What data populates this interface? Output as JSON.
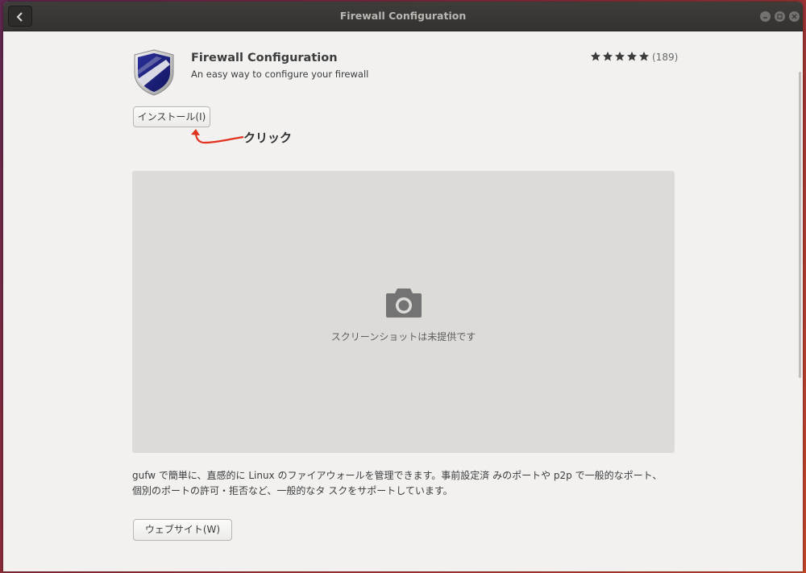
{
  "window": {
    "title": "Firewall Configuration"
  },
  "app": {
    "name": "Firewall Configuration",
    "summary": "An easy way to configure your firewall",
    "rating_stars": 5,
    "review_count": "(189)",
    "install_label": "インストール(I)",
    "annotation": "クリック",
    "annotation_color": "#e0321e",
    "no_screenshot_text": "スクリーンショットは未提供です",
    "description_line1": "gufw で簡単に、直感的に Linux のファイアウォールを管理できます。事前設定済 みのポートや p2p で一般的なポート、",
    "description_line2": "個別のポートの許可・拒否など、一般的なタ スクをサポートしています。",
    "website_label": "ウェブサイト(W)"
  },
  "icons": [
    "back-icon",
    "minimize-icon",
    "maximize-icon",
    "close-icon",
    "shield-icon",
    "star-icon",
    "camera-icon"
  ]
}
